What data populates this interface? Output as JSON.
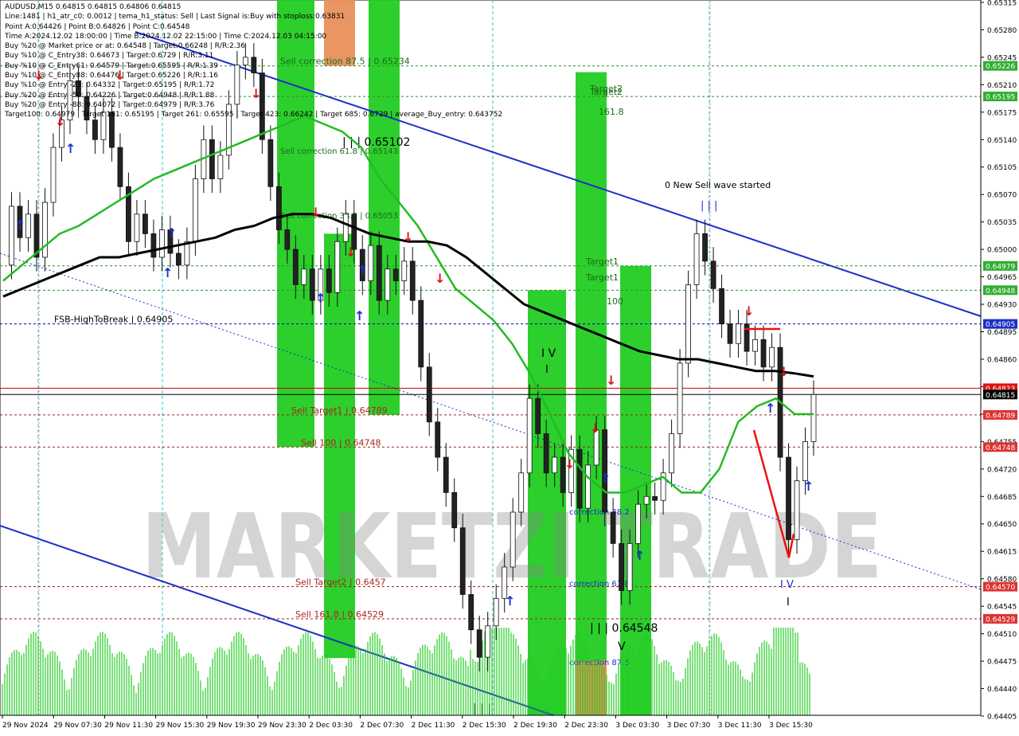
{
  "header": {
    "overlay_title": "0 New Sell wave started",
    "lines": [
      "AUDUSD,M15  0.64815 0.64815 0.64806 0.64815",
      "Line:1481  |  h1_atr_c0: 0.0012  |  tema_h1_status: Sell  |  Last Signal is:Buy with stoploss:0.63831",
      "Point A:0.64426  |  Point B:0.64826  |  Point C:0.64548",
      "Time A:2024.12.02 18:00:00  |  Time B:2024.12.02 22:15:00  |  Time C:2024.12.03 04:15:00",
      "Buy %20 @ Market price or at: 0.64548  |  Target:0.66248  |  R/R:2.36",
      "Buy %10 @ C_Entry38: 0.64673  |  Target:0.6729  |  R/R:3.11",
      "Buy %10 @ C_Entry61: 0.64579  |  Target:0.65595  |  R/R:1.39",
      "Buy %10 @ C_Entry88: 0.64476  |  Target:0.65226  |  R/R:1.16",
      "Buy %10 @ Entry -23: 0.64332  |  Target:0.65195  |  R/R:1.72",
      "Buy %20 @ Entry -50: 0.64226  |  Target:0.64948  |  R/R:1.88",
      "Buy %20 @ Entry -88: 0.64072  |  Target:0.64979  |  R/R:3.76",
      "Target100: 0.64979  |  Target 161: 0.65195  |  Target 261: 0.65595  |  Target 423: 0.66242  |  Target 685: 0.6729  |  average_Buy_entry: 0.643752"
    ]
  },
  "chart_data": {
    "type": "line",
    "symbol": "AUDUSD,M15",
    "ylim": [
      0.64406,
      0.65318
    ],
    "y_ticks": [
      "0.65315",
      "0.65280",
      "0.65245",
      "0.65210",
      "0.65175",
      "0.65140",
      "0.65105",
      "0.65070",
      "0.65035",
      "0.65000",
      "0.64965",
      "0.64930",
      "0.64895",
      "0.64860",
      "0.64825",
      "0.64790",
      "0.64755",
      "0.64720",
      "0.64685",
      "0.64650",
      "0.64615",
      "0.64580",
      "0.64545",
      "0.64510",
      "0.64475",
      "0.64440",
      "0.64405"
    ],
    "x_ticks": [
      "29 Nov 2024",
      "29 Nov 07:30",
      "29 Nov 11:30",
      "29 Nov 15:30",
      "29 Nov 19:30",
      "29 Nov 23:30",
      "2 Dec 03:30",
      "2 Dec 07:30",
      "2 Dec 11:30",
      "2 Dec 15:30",
      "2 Dec 19:30",
      "2 Dec 23:30",
      "3 Dec 03:30",
      "3 Dec 07:30",
      "3 Dec 11:30",
      "3 Dec 15:30"
    ],
    "price_series": [
      0.6498,
      0.65055,
      0.65015,
      0.65045,
      0.6499,
      0.6506,
      0.6513,
      0.65165,
      0.65215,
      0.65195,
      0.65165,
      0.6514,
      0.65175,
      0.6513,
      0.6508,
      0.6501,
      0.65045,
      0.6502,
      0.6499,
      0.65025,
      0.64995,
      0.6498,
      0.6501,
      0.6509,
      0.6514,
      0.6509,
      0.6512,
      0.65185,
      0.65235,
      0.65245,
      0.65225,
      0.6514,
      0.6508,
      0.65025,
      0.65,
      0.64955,
      0.64975,
      0.64935,
      0.64975,
      0.64945,
      0.6501,
      0.65045,
      0.65,
      0.6496,
      0.65005,
      0.64935,
      0.64975,
      0.6496,
      0.64985,
      0.64935,
      0.6485,
      0.6478,
      0.64735,
      0.6469,
      0.64645,
      0.6456,
      0.64515,
      0.6448,
      0.6452,
      0.64555,
      0.64595,
      0.64665,
      0.64715,
      0.6481,
      0.64765,
      0.64715,
      0.64735,
      0.6469,
      0.64745,
      0.6467,
      0.64725,
      0.6477,
      0.64665,
      0.64625,
      0.64565,
      0.64625,
      0.64675,
      0.64685,
      0.6468,
      0.64715,
      0.64765,
      0.64855,
      0.64955,
      0.6502,
      0.64985,
      0.6495,
      0.64905,
      0.6488,
      0.64905,
      0.6487,
      0.64885,
      0.6485,
      0.64875,
      0.64735,
      0.6463,
      0.64705,
      0.64755,
      0.64815
    ],
    "series": [
      {
        "name": "",
        "color": "#22bb22",
        "values": [
          0.6496,
          0.6498,
          0.65,
          0.6502,
          0.6503,
          0.65045,
          0.6506,
          0.65075,
          0.6509,
          0.651,
          0.6511,
          0.6512,
          0.6513,
          0.6514,
          0.6515,
          0.6516,
          0.6517,
          0.6516,
          0.6515,
          0.6513,
          0.6509,
          0.6506,
          0.6503,
          0.6499,
          0.6495,
          0.6493,
          0.6491,
          0.6488,
          0.6484,
          0.6479,
          0.6474,
          0.6471,
          0.6469,
          0.6469,
          0.647,
          0.6471,
          0.6469,
          0.6469,
          0.6472,
          0.6478,
          0.648,
          0.6481,
          0.6479,
          0.6479
        ]
      },
      {
        "name": "",
        "color": "#000000",
        "values": [
          0.6494,
          0.6495,
          0.6496,
          0.6497,
          0.6498,
          0.6499,
          0.6499,
          0.64995,
          0.65,
          0.65005,
          0.6501,
          0.65015,
          0.65025,
          0.6503,
          0.6504,
          0.65045,
          0.65045,
          0.6504,
          0.6503,
          0.6502,
          0.65015,
          0.6501,
          0.6501,
          0.65005,
          0.6499,
          0.6497,
          0.6495,
          0.6493,
          0.6492,
          0.6491,
          0.649,
          0.6489,
          0.6488,
          0.6487,
          0.64865,
          0.6486,
          0.6486,
          0.64855,
          0.6485,
          0.64845,
          0.64845,
          0.64842,
          0.64838
        ]
      }
    ],
    "levels": [
      {
        "label": "Sell correction 87.5 | 0.65234",
        "value": 0.65234,
        "tag": "0.65226",
        "color": "#2e8b2e",
        "dashed": true
      },
      {
        "label": "Target2",
        "value": 0.65195,
        "tag": "0.65195",
        "color": "#2e8b2e",
        "dashed": true
      },
      {
        "label": "Target1",
        "value": 0.64979,
        "tag": "0.64979",
        "color": "#2e8b2e",
        "dashed": true
      },
      {
        "label": "",
        "value": 0.64948,
        "tag": "0.64948",
        "color": "#2e8b2e",
        "dashed": true
      },
      {
        "label": "FSB-HighToBreak | 0.64905",
        "value": 0.64905,
        "tag": "0.64905",
        "color": "#0000cc",
        "dashed": true
      },
      {
        "label": "",
        "value": 0.64823,
        "tag": "0.64823",
        "color": "#cc0000",
        "dashed": false
      },
      {
        "label": "",
        "value": 0.64815,
        "tag": "0.64815",
        "color": "#000000",
        "dashed": false
      },
      {
        "label": "Sell Target1 | 0.64789",
        "value": 0.64789,
        "tag": "0.64789",
        "color": "#a02020",
        "dashed": true
      },
      {
        "label": "Sell 100 | 0.64748",
        "value": 0.64748,
        "tag": "0.64748",
        "color": "#a02020",
        "dashed": true
      },
      {
        "label": "Sell Target2 | 0.6457",
        "value": 0.6457,
        "tag": "0.64570",
        "color": "#a02020",
        "dashed": true
      },
      {
        "label": "Sell 161.8 | 0.64529",
        "value": 0.64529,
        "tag": "0.64529",
        "color": "#a02020",
        "dashed": true
      }
    ],
    "zones": [
      {
        "color": "#22cc22",
        "top": 0.65318,
        "bottom": 0.64748
      },
      {
        "color": "#22cc22",
        "top": 0.6502,
        "bottom": 0.64479
      },
      {
        "color": "#e8905a",
        "top": 0.65318,
        "bottom": 0.65234
      },
      {
        "color": "#22cc22",
        "top": 0.65318,
        "bottom": 0.64789
      },
      {
        "color": "#22cc22",
        "top": 0.64948,
        "bottom": 0.64406
      },
      {
        "color": "#22cc22",
        "top": 0.65226,
        "bottom": 0.64406
      },
      {
        "color": "#e8905a",
        "top": 0.64476,
        "bottom": 0.64406
      },
      {
        "color": "#22cc22",
        "top": 0.64979,
        "bottom": 0.64406
      }
    ],
    "annotations": [
      "Sell correction 61.8 | 0.65143",
      "Sell correction 38.2 | 0.65053",
      "| | | 0.65102",
      "Target1",
      "100",
      "Target2",
      "161.8",
      "correction 38.2",
      "correction 61.8",
      "correction 87.5",
      "| | | 0.64548",
      "V",
      "I V",
      "I",
      "| | |",
      "I V",
      "I"
    ],
    "watermark": "MARKETZI TRADE",
    "bottom_labels": [
      "| | |"
    ]
  }
}
